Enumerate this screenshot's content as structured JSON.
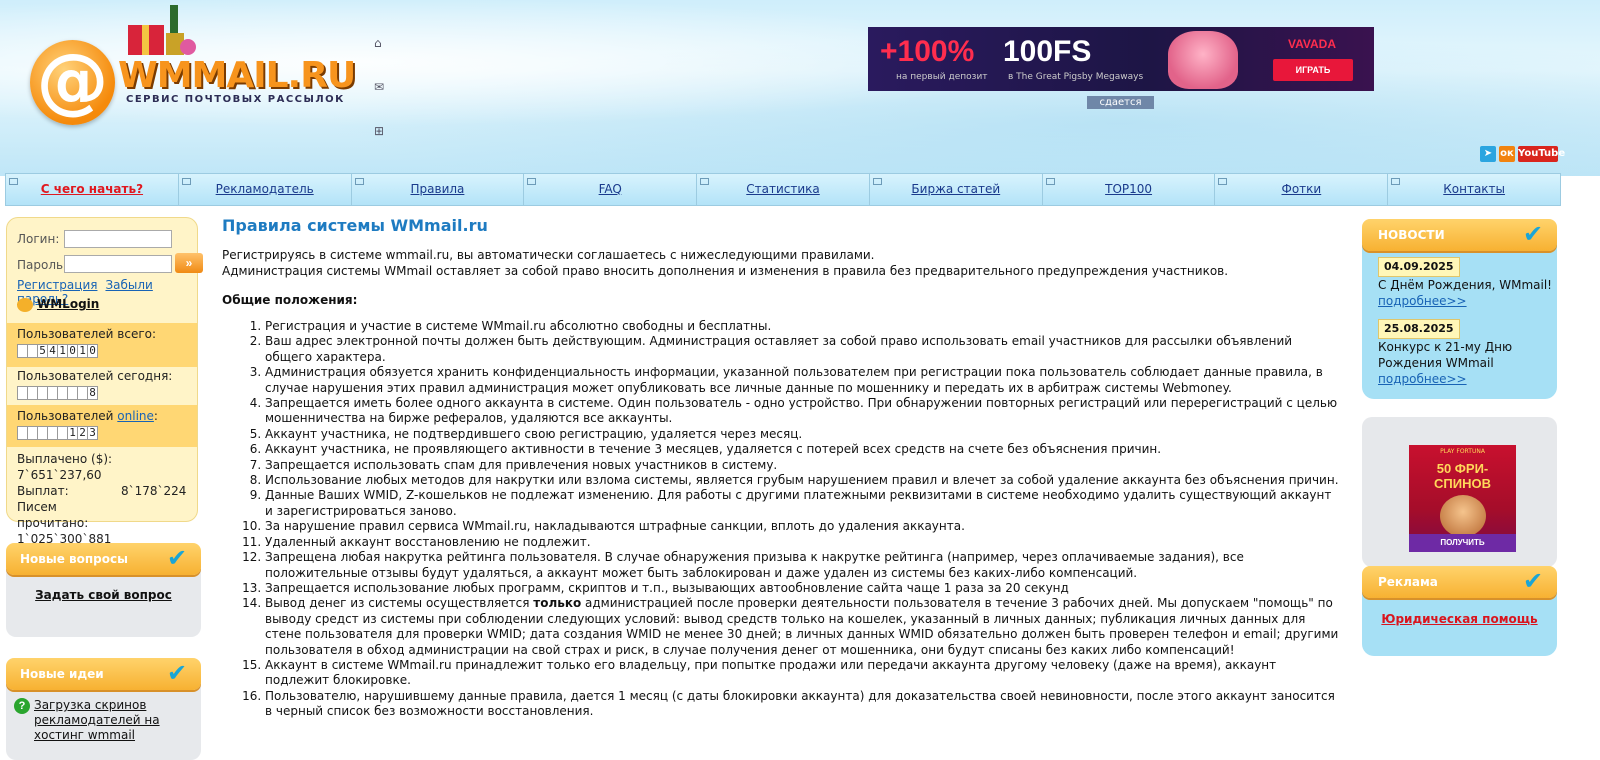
{
  "logo": {
    "name": "WMMAIL.RU",
    "slogan": "СЕРВИС ПОЧТОВЫХ РАССЫЛОК"
  },
  "banner": {
    "percent": "+100%",
    "freespins": "100FS",
    "sub1": "на первый депозит",
    "sub2": "в The Great Pigsby Megaways",
    "brand": "VAVADA",
    "play": "ИГРАТЬ"
  },
  "rent_label": "сдается",
  "socials": {
    "youtube": "YouTube"
  },
  "nav": [
    "С чего начать?",
    "Рекламодатель",
    "Правила",
    "FAQ",
    "Статистика",
    "Биржа статей",
    "TOP100",
    "Фотки",
    "Контакты"
  ],
  "login": {
    "login_label": "Логин:",
    "password_label": "Пароль:",
    "register": "Регистрация",
    "forgot": "Забыли пароль?",
    "wmlogin": "WMLogin"
  },
  "stats": {
    "total_label": "Пользователей всего:",
    "total_digits": [
      "",
      "",
      "5",
      "4",
      "1",
      "0",
      "1",
      "0"
    ],
    "today_label": "Пользователей сегодня:",
    "today_digits": [
      "",
      "",
      "",
      "",
      "",
      "",
      "",
      "8"
    ],
    "online_prefix": "Пользователей ",
    "online_link": "online",
    "online_suffix": ":",
    "online_digits": [
      "",
      "",
      "",
      "",
      "",
      "1",
      "2",
      "3"
    ],
    "paid_label": "Выплачено ($):",
    "paid_value": "7`651`237,60",
    "payouts_label": "Выплат:",
    "payouts_value": "8`178`224",
    "letters_label": "Писем прочитано:",
    "letters_value": "1`025`300`881"
  },
  "questions": {
    "title": "Новые вопросы",
    "ask": "Задать свой вопрос"
  },
  "ideas": {
    "title": "Новые идеи",
    "item": "Загрузка скринов рекламодателей на хостинг wmmail"
  },
  "main": {
    "title": "Правила системы WMmail.ru",
    "intro1": "Регистрируясь в системе wmmail.ru, вы автоматически соглашаетесь с нижеследующими правилами.",
    "intro2": "Администрация системы WMmail оставляет за собой право вносить дополнения и изменения в правила без предварительного предупреждения участников.",
    "section": "Общие положения:",
    "rules": [
      "Регистрация и участие в системе WMmail.ru абсолютно свободны и бесплатны.",
      "Ваш адрес электронной почты должен быть действующим. Администрация оставляет за собой право использовать email участников для рассылки объявлений общего характера.",
      "Администрация обязуется хранить конфиденциальность информации, указанной пользователем при регистрации пока пользователь соблюдает данные правила, в случае нарушения этих правил администрация может опубликовать все личные данные по мошеннику и передать их в арбитраж системы Webmoney.",
      "Запрещается иметь более одного аккаунта в системе. Один пользователь - одно устройство. При обнаружении повторных регистраций или перерегистраций с целью мошенничества на бирже рефералов, удаляются все аккаунты.",
      "Аккаунт участника, не подтвердившего свою регистрацию, удаляется через месяц.",
      "Аккаунт участника, не проявляющего активности в течение 3 месяцев, удаляется с потерей всех средств на счете без объяснения причин.",
      "Запрещается использовать спам для привлечения новых участников в систему.",
      "Использование любых методов для накрутки или взлома системы, является грубым нарушением правил и влечет за собой удаление аккаунта без объяснения причин.",
      "Данные Ваших WMID, Z-кошельков не подлежат изменению. Для работы с другими платежными реквизитами в системе необходимо удалить существующий аккаунт и зарегистрироваться заново.",
      "За нарушение правил сервиса WMmail.ru, накладываются штрафные санкции, вплоть до удаления аккаунта.",
      "Удаленный аккаунт восстановлению не подлежит.",
      "Запрещена любая накрутка рейтинга пользователя. В случае обнаружения призыва к накрутке рейтинга (например, через оплачиваемые задания), все положительные отзывы будут удаляться, а аккаунт может быть заблокирован и даже удален из системы без каких-либо компенсаций.",
      "Запрещается использование любых программ, скриптов и т.п., вызывающих автообновление сайта чаще 1 раза за 20 секунд",
      "Вывод денег из системы осуществляется только администрацией после проверки деятельности пользователя в течение 3 рабочих дней. Мы допускаем \"помощь\" по выводу средст из системы при соблюдении следующих условий: вывод средств только на кошелек, указанный в личных данных; публикация личных данных для стене пользователя для проверки WMID; дата создания WMID не менее 30 дней; в личных данных WMID обязательно должен быть проверен телефон и email; другими пользователя в обход администрации на свой страх и риск, в случае получения денег от мошенника, они будут списаны без каких либо компенсаций!",
      "Аккаунт в системе WMmail.ru принадлежит только его владельцу, при попытке продажи или передачи аккаунта другому человеку (даже на время), аккаунт подлежит блокировке.",
      "Пользователю, нарушившему данные правила, дается 1 месяц (с даты блокировки аккаунта) для доказательства своей невиновности, после этого аккаунт заносится в черный список без возможности восстановления."
    ],
    "rule14_pre": "Вывод денег из системы осуществляется ",
    "rule14_bold": "только",
    "rule14_post": " администрацией после проверки деятельности пользователя в течение 3 рабочих дней. Мы допускаем \"помощь\" по выводу средст из системы при соблюдении следующих условий: вывод средств только на кошелек, указанный в личных данных; публикация личных данных для стене пользователя для проверки WMID; дата создания WMID не менее 30 дней; в личных данных WMID обязательно должен быть проверен телефон и email; другими пользователя в обход администрации на свой страх и риск, в случае получения денег от мошенника, они будут списаны без каких либо компенсаций!"
  },
  "news": {
    "title": "НОВОСТИ",
    "items": [
      {
        "date": "04.09.2025",
        "text": "С Днём Рождения, WMmail!",
        "more": "подробнее>>"
      },
      {
        "date": "25.08.2025",
        "text": "Конкурс к 21-му Дню Рождения WMmail",
        "more": "подробнее>>"
      }
    ]
  },
  "casino_ad": {
    "brand": "PLAY FORTUNA",
    "headline": "50 ФРИ-СПИНОВ",
    "cta": "ПОЛУЧИТЬ"
  },
  "ads": {
    "title": "Реклама",
    "link": "Юридическая помощь"
  },
  "colors": {
    "accent": "#1e7bc1",
    "orange": "#f7b132",
    "red": "#d9151e",
    "news_bg": "#a6e0f5"
  },
  "icons": [
    "home-icon",
    "mail-icon",
    "sitemap-icon",
    "telegram-icon",
    "odnoklassniki-icon",
    "youtube-icon",
    "check-icon",
    "question-icon",
    "arrow-icon",
    "wallet-icon"
  ]
}
